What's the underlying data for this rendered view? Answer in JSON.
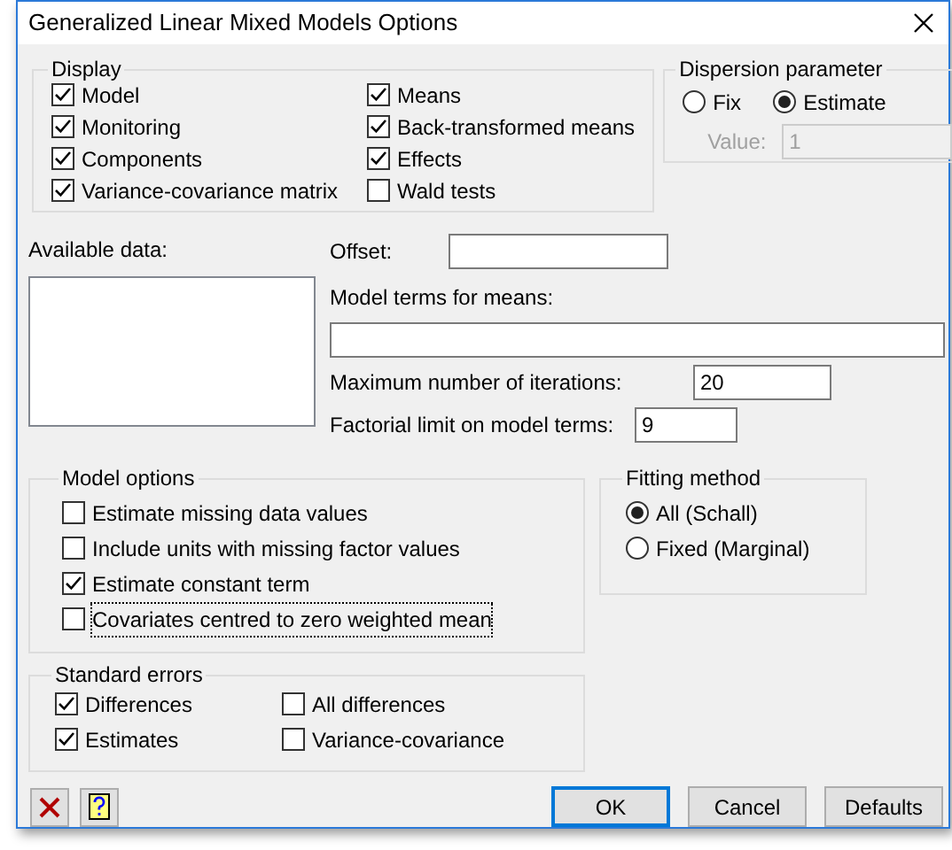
{
  "window": {
    "title": "Generalized Linear Mixed Models Options"
  },
  "display": {
    "title": "Display",
    "options": [
      {
        "label": "Model",
        "checked": true
      },
      {
        "label": "Monitoring",
        "checked": true
      },
      {
        "label": "Components",
        "checked": true
      },
      {
        "label": "Variance-covariance matrix",
        "checked": true
      },
      {
        "label": "Means",
        "checked": true
      },
      {
        "label": "Back-transformed means",
        "checked": true
      },
      {
        "label": "Effects",
        "checked": true
      },
      {
        "label": "Wald tests",
        "checked": false
      }
    ]
  },
  "dispersion": {
    "title": "Dispersion parameter",
    "options": [
      {
        "label": "Fix",
        "selected": false
      },
      {
        "label": "Estimate",
        "selected": true
      }
    ],
    "value_label": "Value:",
    "value": "1",
    "value_disabled": true
  },
  "available_data": {
    "label": "Available data:"
  },
  "offset": {
    "label": "Offset:"
  },
  "model_terms": {
    "label": "Model terms for means:"
  },
  "max_iterations": {
    "label": "Maximum number of iterations:",
    "value": "20"
  },
  "factorial_limit": {
    "label": "Factorial limit on model terms:",
    "value": "9"
  },
  "model_options": {
    "title": "Model options",
    "options": [
      {
        "label": "Estimate missing data values",
        "checked": false,
        "focused": false
      },
      {
        "label": "Include units with missing factor values",
        "checked": false,
        "focused": false
      },
      {
        "label": "Estimate constant term",
        "checked": true,
        "focused": false
      },
      {
        "label": "Covariates centred to zero weighted mean",
        "checked": false,
        "focused": true
      }
    ]
  },
  "fitting_method": {
    "title": "Fitting method",
    "options": [
      {
        "label": "All (Schall)",
        "selected": true
      },
      {
        "label": "Fixed (Marginal)",
        "selected": false
      }
    ]
  },
  "standard_errors": {
    "title": "Standard errors",
    "options": [
      {
        "label": "Differences",
        "checked": true
      },
      {
        "label": "Estimates",
        "checked": true
      },
      {
        "label": "All differences",
        "checked": false
      },
      {
        "label": "Variance-covariance",
        "checked": false
      }
    ]
  },
  "buttons": [
    {
      "label": "OK",
      "default": true
    },
    {
      "label": "Cancel",
      "default": false
    },
    {
      "label": "Defaults",
      "default": false
    }
  ]
}
